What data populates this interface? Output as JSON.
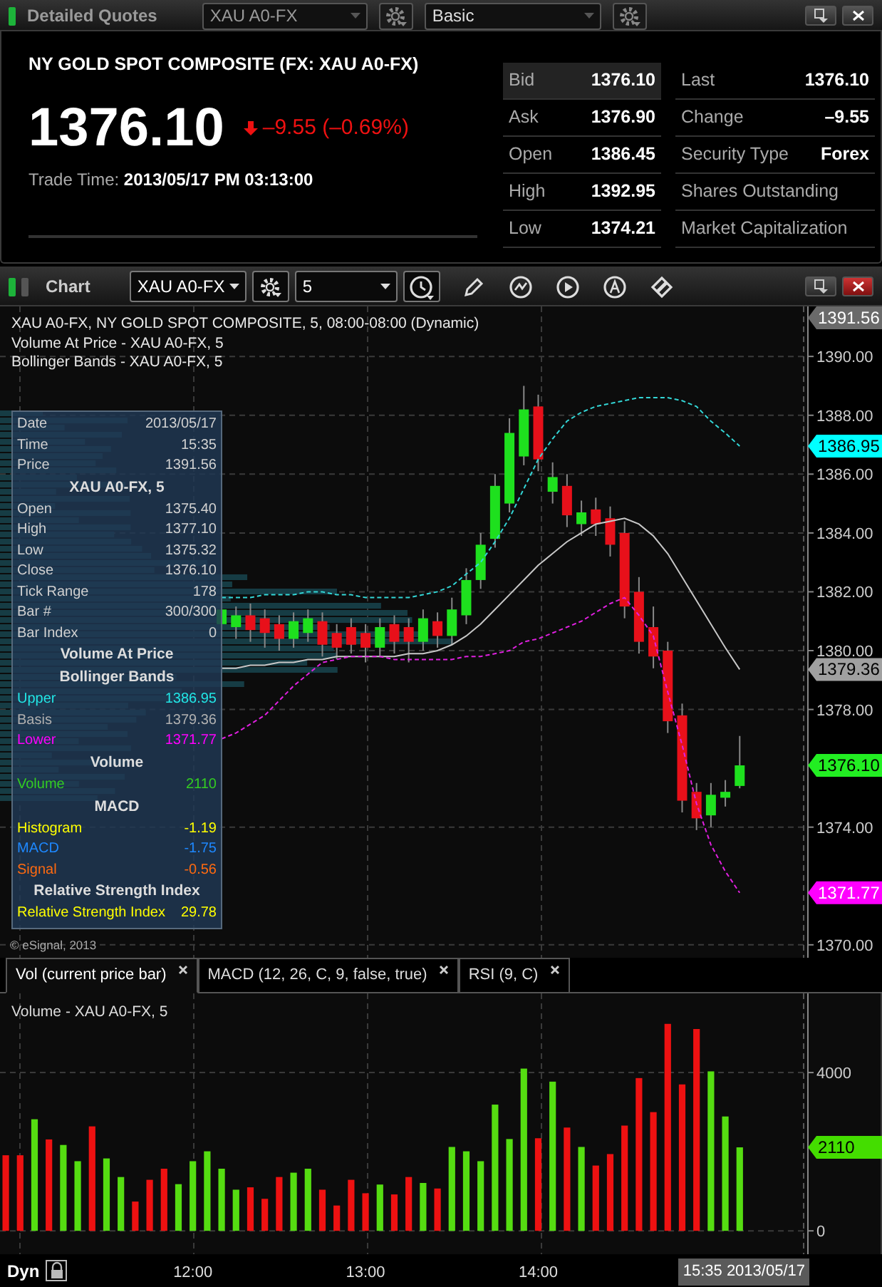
{
  "quotes_panel": {
    "title": "Detailed Quotes",
    "symbol": "XAU A0-FX",
    "layout": "Basic",
    "name": "NY GOLD SPOT COMPOSITE (FX: XAU A0-FX)",
    "last_price": "1376.10",
    "change": {
      "falling": true,
      "text": "–9.55 (–0.69%)"
    },
    "trade_time_label": "Trade Time:",
    "trade_time": "2013/05/17 PM 03:13:00",
    "quote_table": [
      {
        "label": "Bid",
        "value": "1376.10",
        "selected": true
      },
      {
        "label": "Ask",
        "value": "1376.90",
        "selected": false
      },
      {
        "label": "Open",
        "value": "1386.45",
        "selected": false
      },
      {
        "label": "High",
        "value": "1392.95",
        "selected": false
      },
      {
        "label": "Low",
        "value": "1374.21",
        "selected": false
      }
    ],
    "fundamentals": [
      {
        "label": "Last",
        "value": "1376.10"
      },
      {
        "label": "Change",
        "value": "–9.55"
      },
      {
        "label": "Security Type",
        "value": "Forex"
      },
      {
        "label": "Shares Outstanding"
      },
      {
        "label": "Market Capitalization"
      }
    ]
  },
  "chart_panel": {
    "title": "Chart",
    "symbol": "XAU A0-FX",
    "interval": "5",
    "legend": [
      "XAU A0-FX, NY GOLD SPOT COMPOSITE, 5, 08:00-08:00 (Dynamic)",
      "Volume At Price - XAU A0-FX, 5",
      "Bollinger Bands - XAU A0-FX, 5"
    ],
    "data_window": [
      {
        "kind": "row",
        "label": "Date",
        "value": "2013/05/17",
        "color": "#d0d0d0"
      },
      {
        "kind": "row",
        "label": "Time",
        "value": "15:35",
        "color": "#d0d0d0"
      },
      {
        "kind": "row",
        "label": "Price",
        "value": "1391.56",
        "color": "#d0d0d0"
      },
      {
        "kind": "heading",
        "label": "XAU A0-FX, 5"
      },
      {
        "kind": "row",
        "label": "Open",
        "value": "1375.40",
        "color": "#d0d0d0"
      },
      {
        "kind": "row",
        "label": "High",
        "value": "1377.10",
        "color": "#d0d0d0"
      },
      {
        "kind": "row",
        "label": "Low",
        "value": "1375.32",
        "color": "#d0d0d0"
      },
      {
        "kind": "row",
        "label": "Close",
        "value": "1376.10",
        "color": "#d0d0d0"
      },
      {
        "kind": "row",
        "label": "Tick Range",
        "value": "178",
        "color": "#d0d0d0"
      },
      {
        "kind": "row",
        "label": "Bar #",
        "value": "300/300",
        "color": "#d0d0d0"
      },
      {
        "kind": "row",
        "label": "Bar Index",
        "value": "0",
        "color": "#d0d0d0"
      },
      {
        "kind": "heading",
        "label": "Volume At Price"
      },
      {
        "kind": "heading",
        "label": "Bollinger Bands"
      },
      {
        "kind": "row",
        "label": "Upper",
        "value": "1386.95",
        "color": "#22e6e6"
      },
      {
        "kind": "row",
        "label": "Basis",
        "value": "1379.36",
        "color": "#b0b0b0"
      },
      {
        "kind": "row",
        "label": "Lower",
        "value": "1371.77",
        "color": "#ff00ff"
      },
      {
        "kind": "heading",
        "label": "Volume"
      },
      {
        "kind": "row",
        "label": "Volume",
        "value": "2110",
        "color": "#33cc22"
      },
      {
        "kind": "heading",
        "label": "MACD"
      },
      {
        "kind": "row",
        "label": "Histogram",
        "value": "-1.19",
        "color": "#ffff00"
      },
      {
        "kind": "row",
        "label": "MACD",
        "value": "-1.75",
        "color": "#1e88ff"
      },
      {
        "kind": "row",
        "label": "Signal",
        "value": "-0.56",
        "color": "#ff6a10"
      },
      {
        "kind": "heading",
        "label": "Relative Strength Index"
      },
      {
        "kind": "row",
        "label": "Relative Strength Index",
        "value": "29.78",
        "color": "#ffff00"
      }
    ],
    "copyright": "© eSignal, 2013",
    "price_chart": {
      "chart_data": {
        "type": "candlestick",
        "grid": true,
        "ylim": [
          1369.56,
          1391.7
        ],
        "yticks": [
          {
            "value": 1370,
            "label": "1370.00"
          },
          {
            "value": 1374,
            "label": "1374.00"
          },
          {
            "value": 1378,
            "label": "1378.00"
          },
          {
            "value": 1380,
            "label": "1380.00"
          },
          {
            "value": 1382,
            "label": "1382.00"
          },
          {
            "value": 1384,
            "label": "1384.00"
          },
          {
            "value": 1386,
            "label": "1386.00"
          },
          {
            "value": 1388,
            "label": "1388.00"
          },
          {
            "value": 1390,
            "label": "1390.00"
          }
        ],
        "ohlc": [
          null,
          null,
          null,
          null,
          null,
          null,
          null,
          null,
          null,
          null,
          null,
          null,
          null,
          null,
          null,
          [
            1380.9,
            1381.7,
            1380.5,
            1381.4
          ],
          [
            1380.8,
            1381.5,
            1380.4,
            1381.2
          ],
          [
            1381.2,
            1381.6,
            1380.3,
            1380.7
          ],
          [
            1381.1,
            1381.4,
            1380.1,
            1380.6
          ],
          [
            1380.9,
            1381.2,
            1380.0,
            1380.4
          ],
          [
            1380.4,
            1381.3,
            1380.1,
            1381.0
          ],
          [
            1380.6,
            1381.4,
            1380.3,
            1381.1
          ],
          [
            1381.0,
            1381.3,
            1379.8,
            1380.2
          ],
          [
            1380.6,
            1380.9,
            1379.7,
            1380.1
          ],
          [
            1380.8,
            1381.1,
            1379.9,
            1380.2
          ],
          [
            1380.6,
            1380.9,
            1379.6,
            1380.1
          ],
          [
            1380.1,
            1381.1,
            1379.8,
            1380.8
          ],
          [
            1380.9,
            1381.2,
            1379.9,
            1380.3
          ],
          [
            1380.8,
            1381.1,
            1379.6,
            1380.3
          ],
          [
            1380.3,
            1381.4,
            1380.0,
            1381.1
          ],
          [
            1381.0,
            1381.3,
            1380.1,
            1380.5
          ],
          [
            1380.5,
            1381.8,
            1380.2,
            1381.4
          ],
          [
            1381.2,
            1382.8,
            1380.9,
            1382.4
          ],
          [
            1382.4,
            1384.0,
            1382.1,
            1383.6
          ],
          [
            1383.8,
            1386.0,
            1383.5,
            1385.6
          ],
          [
            1385.0,
            1387.9,
            1384.7,
            1387.4
          ],
          [
            1386.6,
            1389.0,
            1386.3,
            1388.2
          ],
          [
            1388.3,
            1388.7,
            1386.1,
            1386.5
          ],
          [
            1385.4,
            1386.4,
            1385.0,
            1385.9
          ],
          [
            1385.6,
            1386.0,
            1384.2,
            1384.6
          ],
          [
            1384.3,
            1385.1,
            1383.9,
            1384.7
          ],
          [
            1384.8,
            1385.2,
            1383.9,
            1384.3
          ],
          [
            1384.5,
            1384.9,
            1383.2,
            1383.6
          ],
          [
            1384.0,
            1384.4,
            1381.1,
            1381.5
          ],
          [
            1382.0,
            1382.5,
            1379.9,
            1380.3
          ],
          [
            1380.8,
            1381.5,
            1379.4,
            1379.8
          ],
          [
            1380.0,
            1380.3,
            1377.2,
            1377.6
          ],
          [
            1377.8,
            1378.2,
            1374.5,
            1374.9
          ],
          [
            1375.2,
            1375.5,
            1373.9,
            1374.3
          ],
          [
            1374.4,
            1375.5,
            1374.0,
            1375.1
          ],
          [
            1375.0,
            1375.6,
            1374.7,
            1375.2
          ],
          [
            1375.4,
            1377.1,
            1375.32,
            1376.1
          ]
        ],
        "series": [
          {
            "type": "line",
            "color": "#33d6d6",
            "line_style": "dashed",
            "values": [
              null,
              null,
              null,
              null,
              null,
              null,
              null,
              null,
              null,
              null,
              null,
              null,
              null,
              null,
              null,
              1381.8,
              1381.8,
              1381.8,
              1381.9,
              1381.9,
              1381.9,
              1382.0,
              1382.0,
              1381.9,
              1381.9,
              1381.8,
              1381.8,
              1381.8,
              1381.8,
              1381.9,
              1382.0,
              1382.2,
              1382.6,
              1383.0,
              1383.7,
              1384.5,
              1385.5,
              1386.5,
              1387.2,
              1387.8,
              1388.1,
              1388.3,
              1388.4,
              1388.5,
              1388.6,
              1388.6,
              1388.6,
              1388.5,
              1388.3,
              1387.8,
              1387.4,
              1386.95
            ]
          },
          {
            "type": "line",
            "color": "#c8c8c8",
            "line_style": "solid",
            "values": [
              null,
              null,
              null,
              null,
              null,
              null,
              null,
              null,
              null,
              null,
              null,
              null,
              null,
              null,
              null,
              1379.4,
              1379.4,
              1379.5,
              1379.5,
              1379.6,
              1379.6,
              1379.7,
              1379.7,
              1379.8,
              1379.8,
              1379.8,
              1379.8,
              1379.8,
              1379.9,
              1379.9,
              1380.0,
              1380.2,
              1380.5,
              1380.9,
              1381.4,
              1381.9,
              1382.4,
              1382.9,
              1383.3,
              1383.7,
              1384.0,
              1384.3,
              1384.4,
              1384.5,
              1384.3,
              1383.9,
              1383.3,
              1382.5,
              1381.7,
              1380.9,
              1380.1,
              1379.36
            ]
          },
          {
            "type": "line",
            "color": "#e020e0",
            "line_style": "dashed",
            "values": [
              null,
              null,
              null,
              null,
              null,
              null,
              null,
              null,
              null,
              null,
              null,
              null,
              null,
              null,
              null,
              1377.0,
              1377.2,
              1377.5,
              1377.8,
              1378.3,
              1378.8,
              1379.2,
              1379.6,
              1379.7,
              1379.8,
              1379.8,
              1379.8,
              1379.7,
              1379.7,
              1379.7,
              1379.7,
              1379.7,
              1379.8,
              1379.8,
              1379.9,
              1380.0,
              1380.3,
              1380.4,
              1380.6,
              1380.8,
              1381.0,
              1381.3,
              1381.6,
              1381.8,
              1381.2,
              1380.5,
              1378.6,
              1376.8,
              1374.8,
              1373.4,
              1372.5,
              1371.77
            ]
          }
        ]
      },
      "markers": [
        {
          "label": "1391.56",
          "color": "#6a6a6a"
        },
        {
          "label": "1386.95",
          "color": "#00ffff"
        },
        {
          "label": "1379.36",
          "color": "#a0a0a0"
        },
        {
          "label": "1376.10",
          "color": "#22ee22"
        },
        {
          "label": "1371.77",
          "color": "#ff00ff"
        }
      ]
    },
    "tabs": [
      {
        "label": "Vol (current price bar)",
        "selected": true
      },
      {
        "label": "MACD (12, 26, C, 9, false, true)",
        "selected": false
      },
      {
        "label": "RSI (9, C)",
        "selected": false
      }
    ],
    "volume_chart": {
      "legend": "Volume - XAU A0-FX, 5",
      "chart_data": {
        "type": "bar",
        "grid": true,
        "ylim": [
          0,
          6000
        ],
        "yticks": [
          0,
          4000
        ],
        "categories": [
          null,
          null,
          null,
          null,
          null,
          null,
          null,
          null,
          null,
          null,
          null,
          null,
          null,
          "12:00",
          null,
          null,
          null,
          null,
          null,
          null,
          null,
          null,
          null,
          null,
          null,
          "13:00",
          null,
          null,
          null,
          null,
          null,
          null,
          null,
          null,
          null,
          null,
          null,
          "14:00",
          null,
          null,
          null,
          null,
          null,
          null,
          null,
          null,
          null,
          null,
          null,
          null,
          null,
          null
        ],
        "series": [
          {
            "color": "#55dd11",
            "values": [
              null,
              null,
              2820,
              null,
              2170,
              1760,
              null,
              1830,
              1360,
              null,
              null,
              null,
              1180,
              1760,
              2010,
              1570,
              1040,
              null,
              null,
              null,
              1470,
              1570,
              null,
              null,
              null,
              null,
              1170,
              null,
              null,
              1210,
              null,
              2120,
              2010,
              1760,
              3190,
              2320,
              4100,
              null,
              3770,
              null,
              2120,
              null,
              null,
              null,
              null,
              null,
              null,
              null,
              null,
              4030,
              2890,
              2110
            ]
          },
          {
            "color": "#ee1111",
            "values": [
              1910,
              1910,
              null,
              2310,
              null,
              null,
              2640,
              null,
              null,
              740,
              1290,
              1570,
              null,
              null,
              null,
              null,
              null,
              1100,
              810,
              1360,
              null,
              null,
              1040,
              640,
              1290,
              950,
              null,
              920,
              1360,
              null,
              1070,
              null,
              null,
              null,
              null,
              null,
              null,
              2340,
              null,
              2610,
              null,
              1650,
              1940,
              2660,
              3860,
              3000,
              5230,
              3700,
              5100,
              null,
              null,
              null
            ]
          }
        ]
      },
      "markers": [
        {
          "label": "2110",
          "color": "#44dd00"
        }
      ]
    },
    "footer": {
      "mode": "Dyn",
      "cursor_time": "15:35 2013/05/17"
    }
  }
}
